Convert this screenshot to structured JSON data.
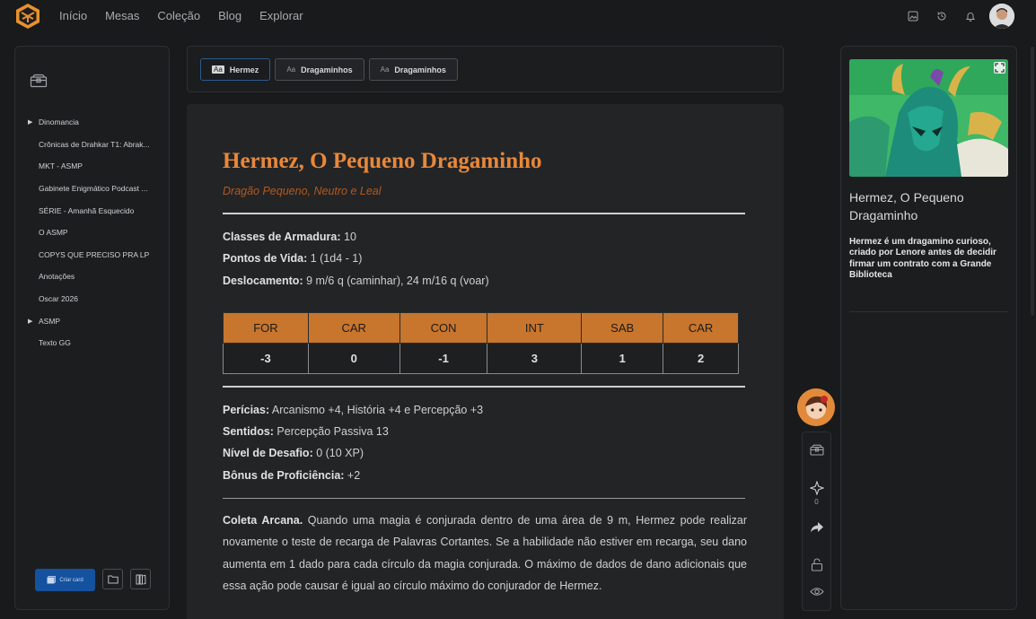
{
  "nav": {
    "items": [
      "Início",
      "Mesas",
      "Coleção",
      "Blog",
      "Explorar"
    ]
  },
  "sidebar": {
    "items": [
      {
        "label": "Dinomancia",
        "expandable": true
      },
      {
        "label": "Crônicas de Drahkar T1: Abrak...",
        "expandable": false
      },
      {
        "label": "MKT - ASMP",
        "expandable": false
      },
      {
        "label": "Gabinete Enigmático Podcast ...",
        "expandable": false
      },
      {
        "label": "SÉRIE - Amanhã Esquecido",
        "expandable": false
      },
      {
        "label": "O ASMP",
        "expandable": false
      },
      {
        "label": "COPYS QUE PRECISO PRA LP",
        "expandable": false
      },
      {
        "label": "Anotações",
        "expandable": false
      },
      {
        "label": "Oscar 2026",
        "expandable": false
      },
      {
        "label": "ASMP",
        "expandable": true
      },
      {
        "label": "Texto GG",
        "expandable": false
      }
    ],
    "create_label": "Criar card"
  },
  "tabs": [
    {
      "icon": "Aa",
      "label": "Hermez",
      "active": true
    },
    {
      "icon": "Aa",
      "label": "Dragaminhos",
      "active": false
    },
    {
      "icon": "Aa",
      "label": "Dragaminhos",
      "active": false
    }
  ],
  "document": {
    "title": "Hermez, O Pequeno Dragaminho",
    "subtitle": "Dragão Pequeno, Neutro e Leal",
    "props": [
      {
        "k": "Classes de Armadura:",
        "v": " 10"
      },
      {
        "k": "Pontos de Vida:",
        "v": " 1 (1d4 - 1)"
      },
      {
        "k": "Deslocamento:",
        "v": " 9 m/6 q (caminhar), 24 m/16 q (voar)"
      }
    ],
    "stats_headers": [
      "FOR",
      "CAR",
      "CON",
      "INT",
      "SAB",
      "CAR"
    ],
    "stats_values": [
      "-3",
      "0",
      "-1",
      "3",
      "1",
      "2"
    ],
    "props2": [
      {
        "k": "Perícias:",
        "v": " Arcanismo +4, História +4 e Percepção +3"
      },
      {
        "k": "Sentidos:",
        "v": " Percepção Passiva 13"
      },
      {
        "k": "Nível de Desafio:",
        "v": " 0 (10 XP)"
      },
      {
        "k": "Bônus de Proficiência:",
        "v": " +2"
      }
    ],
    "action_name": "Coleta Arcana.",
    "action_text": " Quando uma magia é conjurada dentro de uma área de 9 m, Hermez pode realizar novamente o teste de recarga de Palavras Cortantes. Se a habilidade não estiver em recarga, seu dano aumenta em 1 dado para cada círculo da magia conjurada. O máximo de dados de dano adicionais que essa ação pode causar é igual ao círculo máximo do conjurador de Hermez."
  },
  "floating": {
    "like_count": "0"
  },
  "card": {
    "title": "Hermez, O Pequeno Dragaminho",
    "description": "Hermez é um dragamino curioso, criado por Lenore antes de decidir firmar um contrato com a Grande Biblioteca"
  },
  "colors": {
    "accent": "#e8883a",
    "subtitle": "#b3591f",
    "table_header": "#c8752d",
    "primary_button": "#1452a0"
  }
}
